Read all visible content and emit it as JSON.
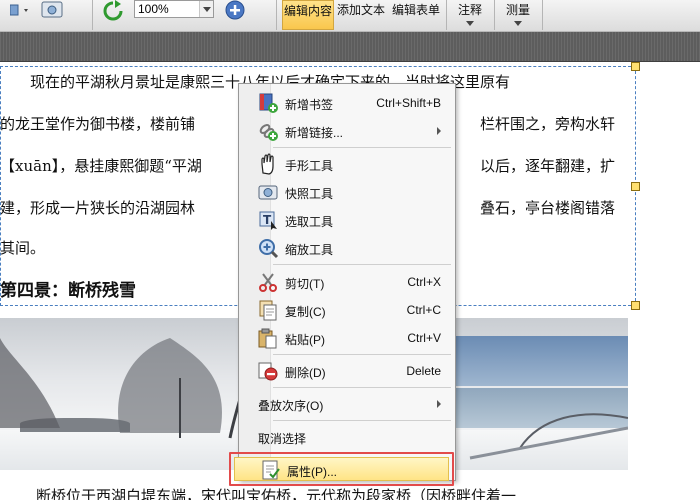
{
  "toolbar": {
    "zoom_value": "100%",
    "tabs": [
      {
        "label": "编辑内容",
        "active": true
      },
      {
        "label": "添加文本",
        "active": false
      },
      {
        "label": "编辑表单",
        "active": false
      },
      {
        "label": "注释",
        "active": false
      },
      {
        "label": "测量",
        "active": false
      }
    ],
    "accent_color": "#f9c74d"
  },
  "document": {
    "lines": [
      "　　现在的平湖秋月景址是康熙三十八年以后才确定下来的。当时将这里原有",
      "的龙王堂作为御书楼，楼前铺",
      "【xuān】，悬挂康熙御题“平湖",
      "建，形成一片狭长的沿湖园林",
      "其间。"
    ],
    "right_fragments": [
      "栏杆围之，旁构水轩",
      "以后，逐年翻建，扩",
      "叠石，亭台楼阁错落"
    ],
    "heading": "第四景：断桥残雪",
    "bottom_text": "断桥位于西湖白堤东端，宋代叫宝佑桥，元代称为段家桥（因桥畔住着一"
  },
  "context_menu": {
    "items": [
      {
        "id": "new-bookmark",
        "label": "新增书签",
        "shortcut": "Ctrl+Shift+B",
        "icon": "bookmark-add-icon"
      },
      {
        "id": "new-link",
        "label": "新增链接...",
        "submenu": true,
        "icon": "link-add-icon"
      },
      {
        "id": "hand-tool",
        "label": "手形工具",
        "icon": "hand-icon"
      },
      {
        "id": "snapshot-tool",
        "label": "快照工具",
        "icon": "camera-icon"
      },
      {
        "id": "select-tool",
        "label": "选取工具",
        "icon": "text-select-icon"
      },
      {
        "id": "zoom-tool",
        "label": "缩放工具",
        "icon": "magnifier-icon"
      },
      {
        "id": "cut",
        "label": "剪切(T)",
        "shortcut": "Ctrl+X",
        "icon": "scissors-icon"
      },
      {
        "id": "copy",
        "label": "复制(C)",
        "shortcut": "Ctrl+C",
        "icon": "copy-icon"
      },
      {
        "id": "paste",
        "label": "粘贴(P)",
        "shortcut": "Ctrl+V",
        "icon": "paste-icon"
      },
      {
        "id": "delete",
        "label": "删除(D)",
        "shortcut": "Delete",
        "icon": "delete-icon"
      },
      {
        "id": "stack-order",
        "label": "叠放次序(O)",
        "submenu": true
      },
      {
        "id": "deselect",
        "label": "取消选择"
      },
      {
        "id": "properties",
        "label": "属性(P)...",
        "icon": "properties-icon",
        "highlighted": true
      }
    ],
    "highlight_color": "#e24b4b"
  }
}
